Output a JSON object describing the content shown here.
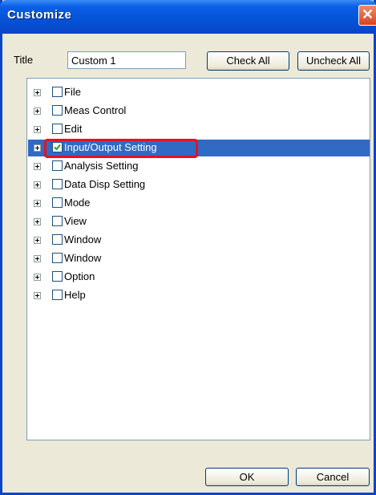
{
  "window": {
    "title": "Customize",
    "close_symbol": "✕"
  },
  "form": {
    "title_label": "Title",
    "title_value": "Custom 1",
    "check_all_label": "Check All",
    "uncheck_all_label": "Uncheck All"
  },
  "tree": {
    "items": [
      {
        "label": "File",
        "checked": false
      },
      {
        "label": "Meas Control",
        "checked": false
      },
      {
        "label": "Edit",
        "checked": false
      },
      {
        "label": "Input/Output Setting",
        "checked": true,
        "selected": true
      },
      {
        "label": "Analysis Setting",
        "checked": false
      },
      {
        "label": "Data Disp Setting",
        "checked": false
      },
      {
        "label": "Mode",
        "checked": false
      },
      {
        "label": "View",
        "checked": false
      },
      {
        "label": "Window",
        "checked": false
      },
      {
        "label": "Window",
        "checked": false
      },
      {
        "label": "Option",
        "checked": false
      },
      {
        "label": "Help",
        "checked": false
      }
    ]
  },
  "footer": {
    "ok_label": "OK",
    "cancel_label": "Cancel"
  },
  "colors": {
    "selection": "#316ac5",
    "highlight_border": "#e8101e",
    "titlebar": "#0452d6"
  }
}
